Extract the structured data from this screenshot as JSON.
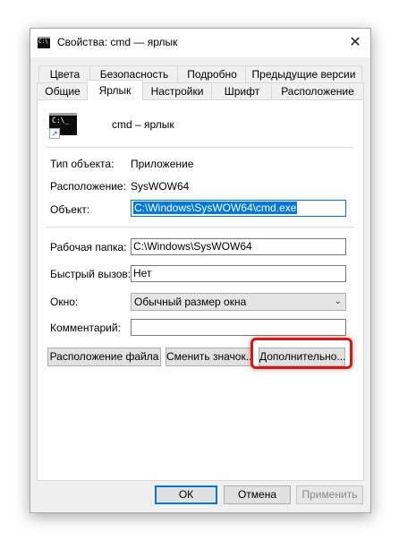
{
  "window": {
    "title": "Свойства: cmd — ярлык",
    "icon": "cmd-icon",
    "close_label": "✕"
  },
  "tabs_row_back": [
    {
      "label": "Цвета"
    },
    {
      "label": "Безопасность"
    },
    {
      "label": "Подробно"
    },
    {
      "label": "Предыдущие версии"
    }
  ],
  "tabs_row_front": [
    {
      "label": "Общие"
    },
    {
      "label": "Ярлык",
      "active": true
    },
    {
      "label": "Настройки"
    },
    {
      "label": "Шрифт"
    },
    {
      "label": "Расположение"
    }
  ],
  "shortcut": {
    "name": "cmd – ярлык",
    "icon_prompt": "C:\\_"
  },
  "fields": {
    "type_label": "Тип объекта:",
    "type_value": "Приложение",
    "location_label": "Расположение:",
    "location_value": "SysWOW64",
    "target_label": "Объект:",
    "target_value": "C:\\Windows\\SysWOW64\\cmd.exe",
    "workdir_label": "Рабочая папка:",
    "workdir_value": "C:\\Windows\\SysWOW64",
    "hotkey_label": "Быстрый вызов:",
    "hotkey_value": "Нет",
    "window_label": "Окно:",
    "window_value": "Обычный размер окна",
    "comment_label": "Комментарий:",
    "comment_value": ""
  },
  "buttons": {
    "open_location": "Расположение файла",
    "change_icon": "Сменить значок...",
    "advanced": "Дополнительно..."
  },
  "footer": {
    "ok": "ОК",
    "cancel": "Отмена",
    "apply": "Применить"
  },
  "colors": {
    "selection": "#0078d7",
    "highlight_ring": "#d11a1a"
  }
}
